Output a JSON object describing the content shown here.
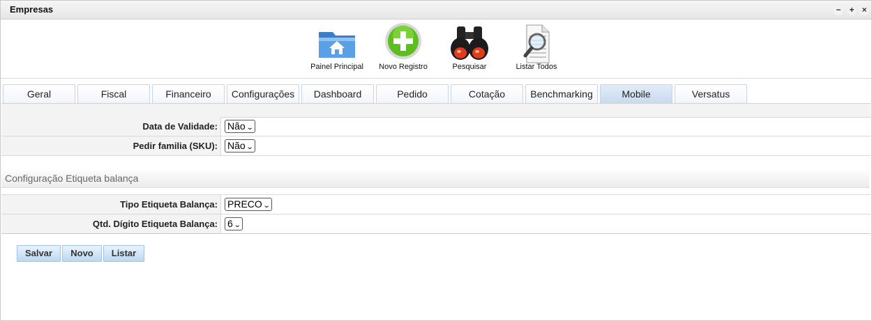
{
  "window": {
    "title": "Empresas"
  },
  "toolbar": {
    "painel": "Painel Principal",
    "novo": "Novo Registro",
    "pesquisar": "Pesquisar",
    "listar": "Listar Todos"
  },
  "tabs": [
    "Geral",
    "Fiscal",
    "Financeiro",
    "Configurações",
    "Dashboard",
    "Pedido",
    "Cotação",
    "Benchmarking",
    "Mobile",
    "Versatus"
  ],
  "active_tab": "Mobile",
  "form": {
    "data_validade": {
      "label": "Data de Validade:",
      "value": "Não"
    },
    "pedir_familia": {
      "label": "Pedir familia (SKU):",
      "value": "Não"
    },
    "section_title": "Configuração Etiqueta balança",
    "tipo_etiqueta": {
      "label": "Tipo Etiqueta Balança:",
      "value": "PRECO"
    },
    "qtd_digito": {
      "label": "Qtd. Dígito Etiqueta Balança:",
      "value": "6"
    }
  },
  "buttons": {
    "salvar": "Salvar",
    "novo": "Novo",
    "listar": "Listar"
  },
  "colors": {
    "accent": "#bcd8f2",
    "add_green": "#5cbf1f"
  }
}
